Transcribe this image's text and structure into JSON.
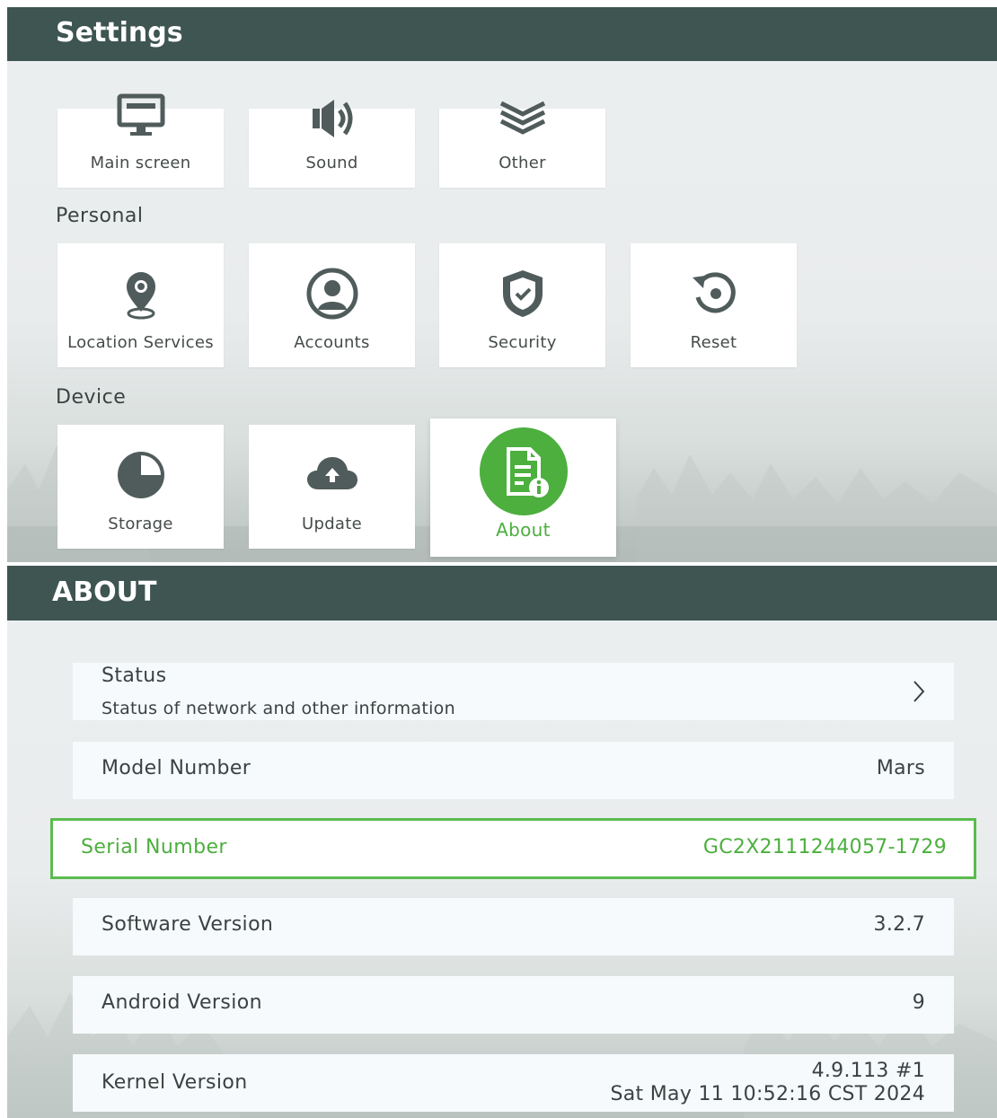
{
  "settings": {
    "title": "Settings",
    "top_row": [
      {
        "label": "Main screen",
        "icon": "monitor-icon"
      },
      {
        "label": "Sound",
        "icon": "speaker-icon"
      },
      {
        "label": "Other",
        "icon": "layers-icon"
      }
    ],
    "personal": {
      "title": "Personal",
      "items": [
        {
          "label": "Location Services",
          "icon": "location-pin-icon"
        },
        {
          "label": "Accounts",
          "icon": "user-circle-icon"
        },
        {
          "label": "Security",
          "icon": "shield-check-icon"
        },
        {
          "label": "Reset",
          "icon": "reset-icon"
        }
      ]
    },
    "device": {
      "title": "Device",
      "items": [
        {
          "label": "Storage",
          "icon": "pie-chart-icon"
        },
        {
          "label": "Update",
          "icon": "cloud-upload-icon"
        },
        {
          "label": "About",
          "icon": "document-info-icon",
          "selected": true
        }
      ]
    }
  },
  "about": {
    "title": "ABOUT",
    "status": {
      "label": "Status",
      "subtitle": "Status of network and other information"
    },
    "rows": {
      "model": {
        "label": "Model Number",
        "value": "Mars"
      },
      "serial": {
        "label": "Serial Number",
        "value": "GC2X2111244057-1729",
        "focused": true
      },
      "software": {
        "label": "Software Version",
        "value": "3.2.7"
      },
      "android": {
        "label": "Android Version",
        "value": "9"
      },
      "kernel": {
        "label": "Kernel Version",
        "value_line1": "4.9.113 #1",
        "value_line2": "Sat May 11 10:52:16 CST 2024"
      }
    }
  },
  "colors": {
    "header": "#3e5551",
    "accent": "#4caf3e",
    "icon": "#505c5b",
    "background": "#eceff0"
  }
}
